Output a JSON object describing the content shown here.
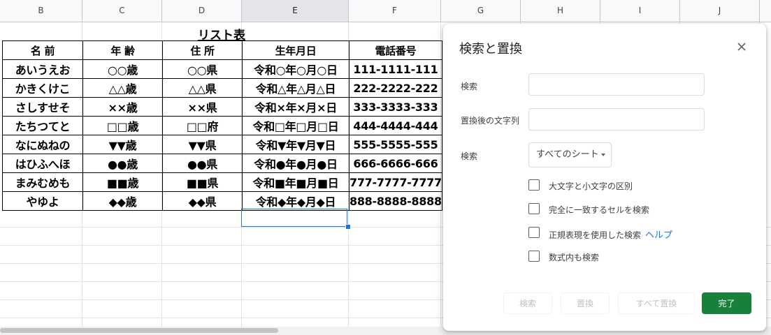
{
  "columns": [
    {
      "label": "B",
      "selected": false
    },
    {
      "label": "C",
      "selected": false
    },
    {
      "label": "D",
      "selected": false
    },
    {
      "label": "E",
      "selected": true
    },
    {
      "label": "F",
      "selected": false
    },
    {
      "label": "G",
      "selected": false
    },
    {
      "label": "H",
      "selected": false
    },
    {
      "label": "I",
      "selected": false
    },
    {
      "label": "J",
      "selected": false
    }
  ],
  "sheet": {
    "title": "リスト表",
    "headers": [
      "名 前",
      "年 齢",
      "住 所",
      "生年月日",
      "電話番号"
    ],
    "rows": [
      [
        "あいうえお",
        "○○歳",
        "○○県",
        "令和○年○月○日",
        "111-1111-111"
      ],
      [
        "かきくけこ",
        "△△歳",
        "△△県",
        "令和△年△月△日",
        "222-2222-222"
      ],
      [
        "さしすせそ",
        "××歳",
        "××県",
        "令和×年×月×日",
        "333-3333-333"
      ],
      [
        "たちつてと",
        "□□歳",
        "□□府",
        "令和□年□月□日",
        "444-4444-444"
      ],
      [
        "なにぬねの",
        "▼▼歳",
        "▼▼県",
        "令和▼年▼月▼日",
        "555-5555-555"
      ],
      [
        "はひふへほ",
        "●●歳",
        "●●県",
        "令和●年●月●日",
        "666-6666-666"
      ],
      [
        "まみむめも",
        "■■歳",
        "■■県",
        "令和■年■月■日",
        "777-7777-7777"
      ],
      [
        "やゆよ",
        "◆◆歳",
        "◆◆県",
        "令和◆年◆月◆日",
        "888-8888-8888"
      ]
    ]
  },
  "dialog": {
    "title": "検索と置換",
    "find_label": "検索",
    "find_value": "",
    "replace_label": "置換後の文字列",
    "replace_value": "",
    "scope_label": "検索",
    "scope_value": "すべてのシート",
    "options": [
      {
        "label": "大文字と小文字の区別",
        "checked": false
      },
      {
        "label": "完全に一致するセルを検索",
        "checked": false
      },
      {
        "label": "正規表現を使用した検索",
        "checked": false,
        "link": "ヘルプ"
      },
      {
        "label": "数式内も検索",
        "checked": false
      }
    ],
    "buttons": {
      "find": "検索",
      "replace": "置換",
      "replace_all": "すべて置換",
      "done": "完了"
    },
    "colors": {
      "primary": "#188038",
      "link": "#1a73e8"
    }
  }
}
